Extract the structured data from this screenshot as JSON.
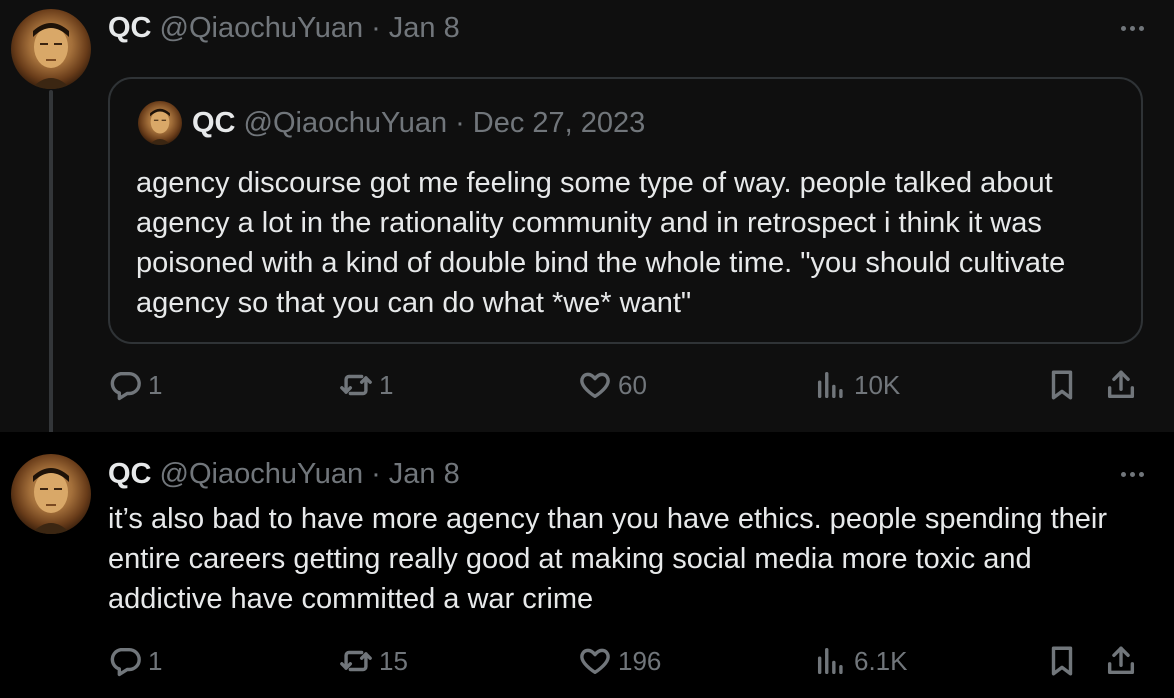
{
  "tweets": [
    {
      "name": "QC",
      "handle": "@QiaochuYuan",
      "date": "Jan 8",
      "quote": {
        "name": "QC",
        "handle": "@QiaochuYuan",
        "date": "Dec 27, 2023",
        "text": "agency discourse got me feeling some type of way. people talked about agency a lot in the rationality community and in retrospect i think it was poisoned with a kind of double bind the whole time. \"you should cultivate agency so that you can do what *we* want\""
      },
      "replies": "1",
      "reposts": "1",
      "likes": "60",
      "views": "10K"
    },
    {
      "name": "QC",
      "handle": "@QiaochuYuan",
      "date": "Jan 8",
      "text": "it’s also bad to have more agency than you have ethics. people spending their entire careers getting really good at making social media more toxic and addictive have committed a war crime",
      "replies": "1",
      "reposts": "15",
      "likes": "196",
      "views": "6.1K"
    }
  ],
  "separator": "·",
  "colors": {
    "background": "#000000",
    "thread_background": "#0f0f0f",
    "text": "#e7e9ea",
    "muted": "#71767b",
    "border": "#2f3336"
  }
}
